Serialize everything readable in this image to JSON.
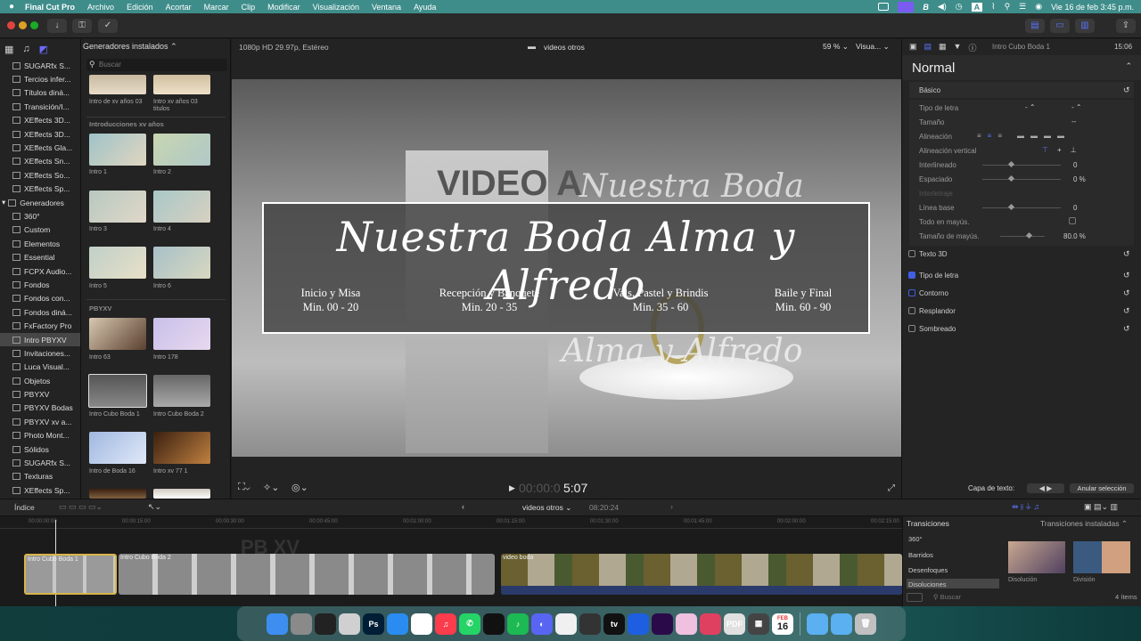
{
  "menubar": {
    "app": "Final Cut Pro",
    "items": [
      "Archivo",
      "Edición",
      "Acortar",
      "Marcar",
      "Clip",
      "Modificar",
      "Visualización",
      "Ventana",
      "Ayuda"
    ],
    "datetime": "Vie 16 de feb  3:45 p.m."
  },
  "libraries": {
    "items": [
      "SUGARfx S...",
      "Tercios infer...",
      "Títulos diná...",
      "Transición/I...",
      "XEffects 3D...",
      "XEffects 3D...",
      "XEffects Gla...",
      "XEffects Sn...",
      "XEffects So...",
      "XEffects Sp...",
      "Generadores",
      "360°",
      "Custom",
      "Elementos",
      "Essential",
      "FCPX Audio...",
      "Fondos",
      "Fondos con...",
      "Fondos diná...",
      "FxFactory Pro",
      "Intro PBYXV",
      "Invitaciones...",
      "Luca Visual...",
      "Objetos",
      "PBYXV",
      "PBYXV Bodas",
      "PBYXV xv a...",
      "Photo Mont...",
      "Sólidos",
      "SUGARfx S...",
      "Texturas",
      "XEffects Sp..."
    ]
  },
  "browser": {
    "header": "Generadores instalados",
    "search_placeholder": "Buscar",
    "top_captions": [
      "Intro de xv años 03",
      "Intro xv años 03 titulos"
    ],
    "section1": "Introducciones xv años",
    "intro_captions": [
      "Intro 1",
      "Intro 2",
      "Intro 3",
      "Intro 4",
      "Intro 5",
      "Intro 6"
    ],
    "section2": "PBYXV",
    "pbyxv_captions": [
      "Intro 63",
      "Intro 178",
      "Intro Cubo Boda 1",
      "Intro Cubo Boda 2",
      "Intro de Boda 16",
      "Intro xv 77 1"
    ]
  },
  "viewer": {
    "format": "1080p HD 29.97p, Estéreo",
    "project": "videos otros",
    "zoom": "59 %",
    "view": "Visua...",
    "title_line": "Nuestra Boda Alma y Alfredo",
    "schedule": [
      {
        "label": "Inicio y Misa",
        "range": "Min. 00 - 20"
      },
      {
        "label": "Recepción y Banquete",
        "range": "Min. 20 - 35"
      },
      {
        "label": "Vals, Pastel y Brindis",
        "range": "Min. 35 - 60"
      },
      {
        "label": "Baile y Final",
        "range": "Min. 60 - 90"
      }
    ],
    "timecode_dim": "00:00:0",
    "timecode": "5:07"
  },
  "inspector": {
    "clip_name": "Intro Cubo Boda 1",
    "duration": "15:06",
    "preset": "Normal",
    "basic": "Básico",
    "rows": [
      "Tipo de letra",
      "Tamaño",
      "Alineación",
      "Alineación vertical",
      "Interlineado",
      "Espaciado",
      "Interletraje",
      "Línea base",
      "Todo en mayús.",
      "Tamaño de mayús."
    ],
    "vals": {
      "interlineado": "0",
      "espaciado": "0 %",
      "linea_base": "0",
      "mayus": "80.0 %"
    },
    "sections": [
      "Texto 3D",
      "Tipo de letra",
      "Contorno",
      "Resplandor",
      "Sombreado"
    ],
    "capa_label": "Capa de texto:",
    "deselect": "Anular selección"
  },
  "timeline": {
    "index": "Índice",
    "project": "videos otros",
    "duration": "08:20:24",
    "ruler": [
      "00:00:00:00",
      "00:00:15:00",
      "00:00:30:00",
      "00:00:45:00",
      "00:01:00:00",
      "00:01:15:00",
      "00:01:30:00",
      "00:01:45:00",
      "00:02:00:00",
      "00:02:15:00"
    ],
    "clips": [
      "Intro Cubo Boda 1",
      "Intro Cubo Boda 2",
      "video boda"
    ]
  },
  "transitions": {
    "title": "Transiciones",
    "installed": "Transiciones instaladas",
    "cats": [
      "360°",
      "Barridos",
      "Desenfoques",
      "Disoluciones"
    ],
    "items": [
      "Disolución",
      "División"
    ],
    "search": "Buscar",
    "count": "4 ítems"
  },
  "dock": {
    "apps": [
      "finder",
      "launchpad",
      "final-cut",
      "imovie",
      "photoshop",
      "safari",
      "chrome",
      "music",
      "whatsapp",
      "capcut",
      "spotify",
      "discord",
      "robinhoodie",
      "vpn",
      "appletv",
      "bluetooth",
      "premiere",
      "setapp",
      "tracker",
      "pdf",
      "calculator",
      "calendar",
      "folder",
      "downloads",
      "trash"
    ],
    "calendar_day": "16",
    "calendar_month": "FEB"
  },
  "colors": {
    "menubar": "#3e8d8b",
    "accent": "#3f5fe6",
    "selection": "#474747"
  }
}
